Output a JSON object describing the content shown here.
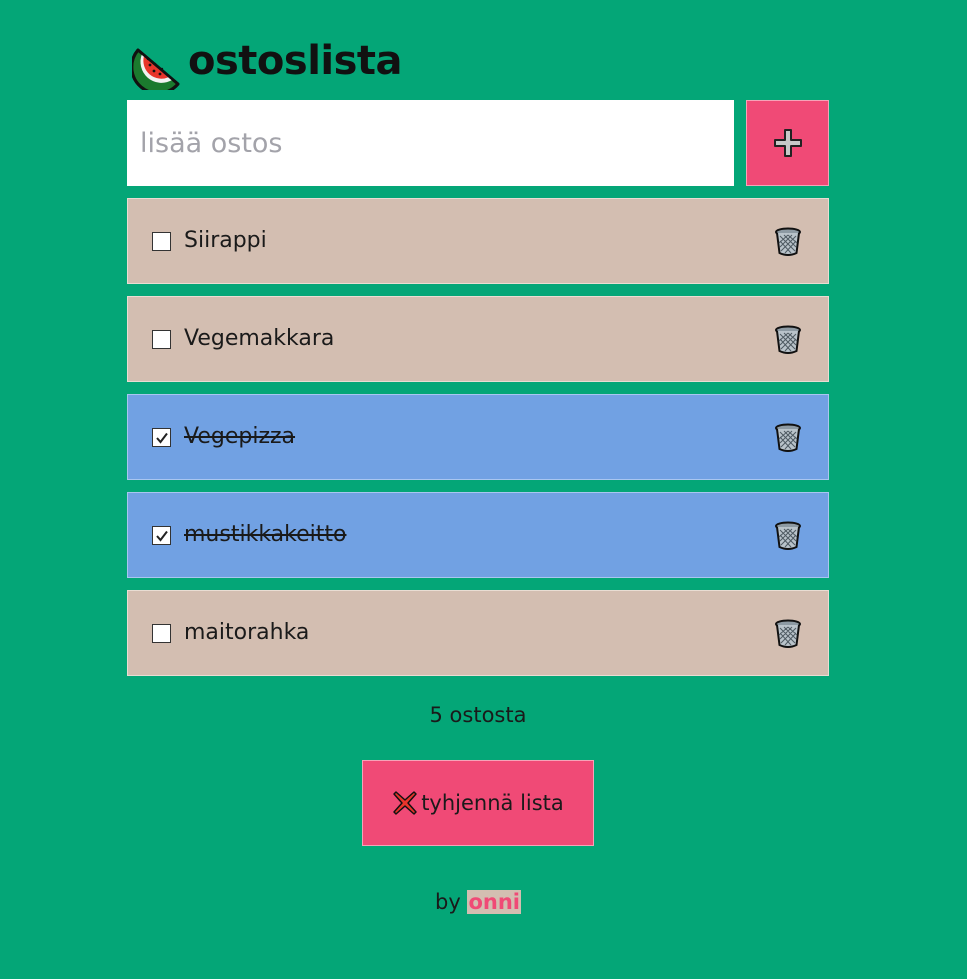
{
  "app": {
    "title": "ostoslista",
    "logo_icon": "watermelon-icon"
  },
  "add_form": {
    "placeholder": "lisää ostos",
    "value": "",
    "button_icon": "plus-icon"
  },
  "items": [
    {
      "label": "Siirappi",
      "checked": false
    },
    {
      "label": "Vegemakkara",
      "checked": false
    },
    {
      "label": "Vegepizza",
      "checked": true
    },
    {
      "label": "mustikkakeitto",
      "checked": true
    },
    {
      "label": "maitorahka",
      "checked": false
    }
  ],
  "item_delete_icon": "wastebasket-icon",
  "counter": {
    "text": "5 ostosta"
  },
  "clear_button": {
    "icon": "cross-mark-icon",
    "label": "tyhjennä lista"
  },
  "footer": {
    "prefix": "by",
    "author": "onni"
  },
  "colors": {
    "background": "#04a677",
    "accent": "#f04a76",
    "item_unchecked": "#d3beb1",
    "item_checked": "#71a1e3",
    "input_background": "#ffffff"
  }
}
